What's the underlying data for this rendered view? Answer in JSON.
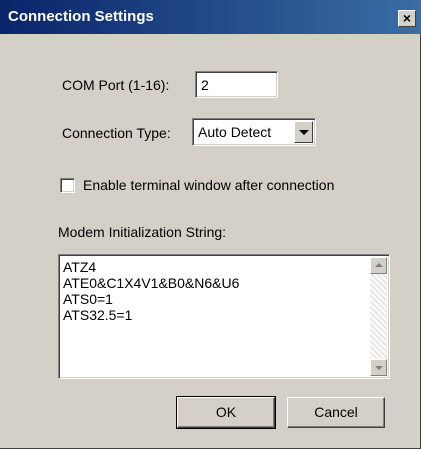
{
  "window": {
    "title": "Connection Settings",
    "close_glyph": "×"
  },
  "com_port": {
    "label": "COM Port (1-16):",
    "value": "2"
  },
  "connection_type": {
    "label": "Connection Type:",
    "selected": "Auto Detect"
  },
  "terminal_window": {
    "label": "Enable terminal window after connection",
    "checked": false
  },
  "modem_init": {
    "label": "Modem Initialization String:",
    "lines": [
      "ATZ4",
      "ATE0&C1X4V1&B0&N6&U6",
      "ATS0=1",
      "ATS32.5=1"
    ]
  },
  "buttons": {
    "ok": "OK",
    "cancel": "Cancel"
  },
  "icons": {
    "close": "close-icon",
    "dropdown": "chevron-down-icon",
    "scroll_up": "scroll-up-icon",
    "scroll_down": "scroll-down-icon"
  },
  "colors": {
    "title_bar": "#0a246a",
    "dialog_bg": "#d4d0c8"
  }
}
